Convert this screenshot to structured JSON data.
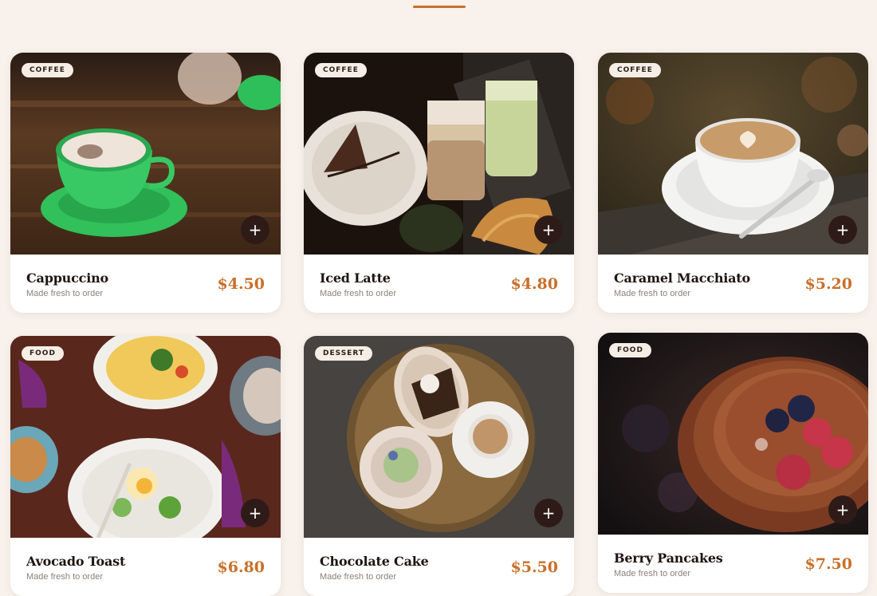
{
  "menu": {
    "add_symbol": "+",
    "items": [
      {
        "name": "Cappuccino",
        "category": "COFFEE",
        "subtitle": "Made fresh to order",
        "price": "$4.50",
        "photo_icon": "cappuccino-photo"
      },
      {
        "name": "Iced Latte",
        "category": "COFFEE",
        "subtitle": "Made fresh to order",
        "price": "$4.80",
        "photo_icon": "iced-latte-photo"
      },
      {
        "name": "Caramel Macchiato",
        "category": "COFFEE",
        "subtitle": "Made fresh to order",
        "price": "$5.20",
        "photo_icon": "caramel-macchiato-photo"
      },
      {
        "name": "Avocado Toast",
        "category": "FOOD",
        "subtitle": "Made fresh to order",
        "price": "$6.80",
        "photo_icon": "avocado-toast-photo"
      },
      {
        "name": "Chocolate Cake",
        "category": "DESSERT",
        "subtitle": "Made fresh to order",
        "price": "$5.50",
        "photo_icon": "chocolate-cake-photo"
      },
      {
        "name": "Berry Pancakes",
        "category": "FOOD",
        "subtitle": "Made fresh to order",
        "price": "$7.50",
        "photo_icon": "berry-pancakes-photo"
      }
    ]
  },
  "theme": {
    "accent": "#c9702a",
    "background": "#f8f1ec",
    "button": "#2e1b17"
  }
}
